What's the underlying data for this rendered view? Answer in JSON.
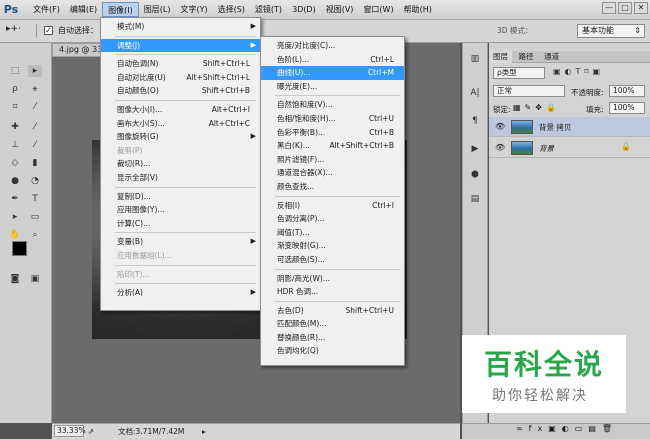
{
  "app": {
    "logo": "Ps"
  },
  "menubar": {
    "items": [
      "文件(F)",
      "编辑(E)",
      "图像(I)",
      "图层(L)",
      "文字(Y)",
      "选择(S)",
      "滤镜(T)",
      "3D(D)",
      "视图(V)",
      "窗口(W)",
      "帮助(H)"
    ],
    "window_buttons": [
      "—",
      "□",
      "✕"
    ]
  },
  "optbar": {
    "auto_select_label": "自动选择：",
    "mode_3d_label": "3D 模式：",
    "workspace": "基本功能"
  },
  "document": {
    "tab_title": "4.jpg @ 33.3..."
  },
  "image_menu": {
    "items": [
      {
        "label": "模式(M)",
        "shortcut": "",
        "submenu": true
      },
      {
        "label": "调整(J)",
        "shortcut": "",
        "submenu": true
      },
      {
        "label": "自动色调(N)",
        "shortcut": "Shift+Ctrl+L"
      },
      {
        "label": "自动对比度(U)",
        "shortcut": "Alt+Shift+Ctrl+L"
      },
      {
        "label": "自动颜色(O)",
        "shortcut": "Shift+Ctrl+B"
      },
      {
        "label": "图像大小(I)...",
        "shortcut": "Alt+Ctrl+I"
      },
      {
        "label": "画布大小(S)...",
        "shortcut": "Alt+Ctrl+C"
      },
      {
        "label": "图像旋转(G)",
        "shortcut": "",
        "submenu": true
      },
      {
        "label": "裁剪(P)",
        "shortcut": ""
      },
      {
        "label": "裁切(R)...",
        "shortcut": ""
      },
      {
        "label": "显示全部(V)",
        "shortcut": ""
      },
      {
        "label": "复制(D)...",
        "shortcut": ""
      },
      {
        "label": "应用图像(Y)...",
        "shortcut": ""
      },
      {
        "label": "计算(C)...",
        "shortcut": ""
      },
      {
        "label": "变量(B)",
        "shortcut": "",
        "submenu": true
      },
      {
        "label": "应用数据组(L)...",
        "shortcut": ""
      },
      {
        "label": "陷印(T)...",
        "shortcut": ""
      },
      {
        "label": "分析(A)",
        "shortcut": "",
        "submenu": true
      }
    ]
  },
  "adjust_menu": {
    "items": [
      {
        "label": "亮度/对比度(C)...",
        "shortcut": ""
      },
      {
        "label": "色阶(L)...",
        "shortcut": "Ctrl+L"
      },
      {
        "label": "曲线(U)...",
        "shortcut": "Ctrl+M"
      },
      {
        "label": "曝光度(E)...",
        "shortcut": ""
      },
      {
        "label": "自然饱和度(V)...",
        "shortcut": ""
      },
      {
        "label": "色相/饱和度(H)...",
        "shortcut": "Ctrl+U"
      },
      {
        "label": "色彩平衡(B)...",
        "shortcut": "Ctrl+B"
      },
      {
        "label": "黑白(K)...",
        "shortcut": "Alt+Shift+Ctrl+B"
      },
      {
        "label": "照片滤镜(F)...",
        "shortcut": ""
      },
      {
        "label": "通道混合器(X)...",
        "shortcut": ""
      },
      {
        "label": "颜色查找...",
        "shortcut": ""
      },
      {
        "label": "反相(I)",
        "shortcut": "Ctrl+I"
      },
      {
        "label": "色调分离(P)...",
        "shortcut": ""
      },
      {
        "label": "阈值(T)...",
        "shortcut": ""
      },
      {
        "label": "渐变映射(G)...",
        "shortcut": ""
      },
      {
        "label": "可选颜色(S)...",
        "shortcut": ""
      },
      {
        "label": "阴影/高光(W)...",
        "shortcut": ""
      },
      {
        "label": "HDR 色调...",
        "shortcut": ""
      },
      {
        "label": "去色(D)",
        "shortcut": "Shift+Ctrl+U"
      },
      {
        "label": "匹配颜色(M)...",
        "shortcut": ""
      },
      {
        "label": "替换颜色(R)...",
        "shortcut": ""
      },
      {
        "label": "色调均化(Q)",
        "shortcut": ""
      }
    ]
  },
  "layers_panel": {
    "tabs": [
      "图层",
      "路径",
      "通道"
    ],
    "kind_filter": "ρ类型",
    "blend_mode": "正常",
    "opacity_label": "不透明度:",
    "opacity_value": "100%",
    "lock_label": "锁定:",
    "fill_label": "填充:",
    "fill_value": "100%",
    "layers": [
      {
        "name": "背景 拷贝",
        "selected": true,
        "locked": false
      },
      {
        "name": "背景",
        "selected": false,
        "locked": true
      }
    ]
  },
  "status": {
    "zoom": "33.33%",
    "doc_info": "文档:3.71M/7.42M"
  },
  "watermark": {
    "title": "百科全说",
    "subtitle": "助你轻松解决"
  }
}
